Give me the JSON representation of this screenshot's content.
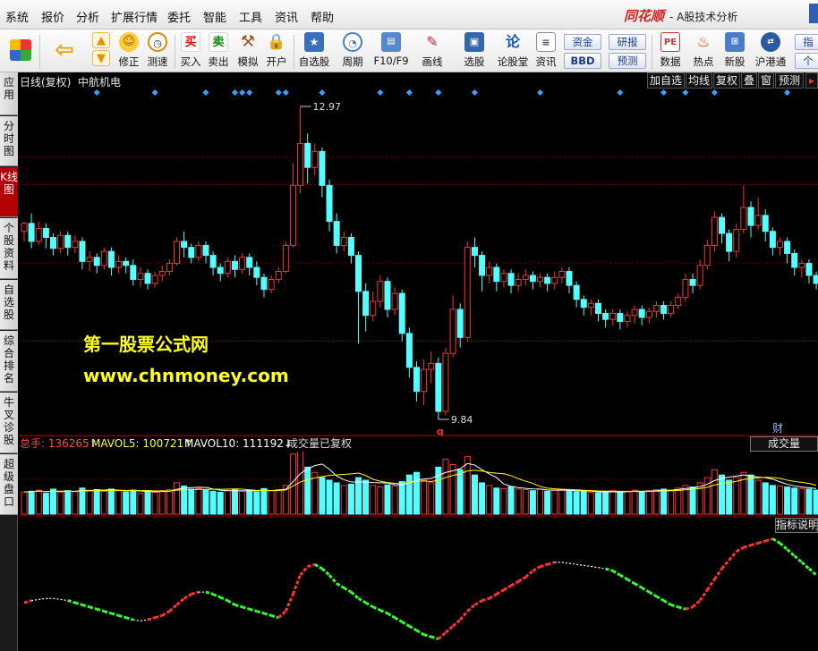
{
  "menubar": {
    "items": [
      "系统",
      "报价",
      "分析",
      "扩展行情",
      "委托",
      "智能",
      "工具",
      "资讯",
      "帮助"
    ],
    "brand": "同花顺",
    "subtitle": "- A股技术分析"
  },
  "toolbar": {
    "buttons": [
      {
        "label": "",
        "icon": "grid-icon"
      },
      {
        "label": "",
        "icon": "back-arrow-icon"
      },
      {
        "label": "修正",
        "icon": "smiley-icon"
      },
      {
        "label": "测速",
        "icon": "clock-icon"
      },
      {
        "label": "买入",
        "icon": "buy-icon",
        "glyph": "买"
      },
      {
        "label": "卖出",
        "icon": "sell-icon",
        "glyph": "卖"
      },
      {
        "label": "模拟",
        "icon": "hammer-icon"
      },
      {
        "label": "开户",
        "icon": "lock-icon"
      },
      {
        "label": "自选股",
        "icon": "star-folder-icon"
      },
      {
        "label": "周期",
        "icon": "period-icon"
      },
      {
        "label": "F10/F9",
        "icon": "f10-icon"
      },
      {
        "label": "画线",
        "icon": "pen-icon"
      },
      {
        "label": "选股",
        "icon": "monitor-icon"
      },
      {
        "label": "论股堂",
        "icon": "forum-icon",
        "glyph": "论"
      },
      {
        "label": "资讯",
        "icon": "news-icon"
      },
      {
        "label": "数据",
        "icon": "pe-icon",
        "glyph": "PE"
      },
      {
        "label": "热点",
        "icon": "hot-icon"
      },
      {
        "label": "新股",
        "icon": "ipo-icon"
      },
      {
        "label": "沪港通",
        "icon": "hk-icon"
      }
    ],
    "mini": {
      "fund": "资金",
      "bbd": "BBD",
      "research": "研报",
      "forecast": "预测",
      "index": "指",
      "stock": "个"
    }
  },
  "sidetabs": [
    {
      "label": "应用",
      "active": false
    },
    {
      "label": "分时图",
      "active": false
    },
    {
      "label": "K线图",
      "active": true
    },
    {
      "label": "个股资料",
      "active": false
    },
    {
      "label": "自选股",
      "active": false
    },
    {
      "label": "综合排名",
      "active": false
    },
    {
      "label": "牛叉诊股",
      "active": false
    },
    {
      "label": "超级盘口",
      "active": false
    }
  ],
  "chart_header": {
    "period": "日线(复权)",
    "stock": "中航机电",
    "buttons": [
      "加自选",
      "均线",
      "复权",
      "叠",
      "窗",
      "预测"
    ]
  },
  "price": {
    "high_label": "12.97",
    "low_label": "9.84",
    "low_marker": "q",
    "fin_marker": "财"
  },
  "watermark": {
    "line1": "第一股票公式网",
    "line2": "www.chnmoney.com"
  },
  "volume_header": {
    "total": "总手: 136265↑",
    "mavol5": "MAVOL5: 100721↑",
    "mavol10": "MAVOL10: 111192↓",
    "note": "成交量已复权",
    "tab": "成交量"
  },
  "indicator": {
    "tab": "指标说明"
  },
  "colors": {
    "up": "#ff3232",
    "down": "#54ffff",
    "ma5": "#ffffff",
    "ma10": "#ffff00",
    "ind_up": "#ff3232",
    "ind_down": "#32ff32",
    "ind_flat": "#ffffff"
  },
  "chart_data": {
    "type": "candlestick",
    "high": 12.97,
    "low": 9.84,
    "candles": [
      [
        11.72,
        11.8,
        11.62,
        11.82
      ],
      [
        11.8,
        11.62,
        11.55,
        11.9
      ],
      [
        11.62,
        11.75,
        11.58,
        11.82
      ],
      [
        11.75,
        11.66,
        11.55,
        11.8
      ],
      [
        11.66,
        11.55,
        11.48,
        11.7
      ],
      [
        11.55,
        11.68,
        11.5,
        11.72
      ],
      [
        11.68,
        11.56,
        11.48,
        11.72
      ],
      [
        11.56,
        11.62,
        11.5,
        11.68
      ],
      [
        11.62,
        11.42,
        11.34,
        11.66
      ],
      [
        11.42,
        11.46,
        11.32,
        11.52
      ],
      [
        11.46,
        11.38,
        11.3,
        11.5
      ],
      [
        11.38,
        11.52,
        11.34,
        11.56
      ],
      [
        11.52,
        11.36,
        11.28,
        11.56
      ],
      [
        11.36,
        11.42,
        11.3,
        11.48
      ],
      [
        11.42,
        11.38,
        11.3,
        11.46
      ],
      [
        11.38,
        11.24,
        11.18,
        11.44
      ],
      [
        11.24,
        11.3,
        11.16,
        11.36
      ],
      [
        11.3,
        11.2,
        11.14,
        11.34
      ],
      [
        11.2,
        11.28,
        11.16,
        11.32
      ],
      [
        11.28,
        11.32,
        11.22,
        11.38
      ],
      [
        11.32,
        11.4,
        11.28,
        11.44
      ],
      [
        11.4,
        11.62,
        11.38,
        11.66
      ],
      [
        11.62,
        11.56,
        11.46,
        11.72
      ],
      [
        11.56,
        11.46,
        11.4,
        11.6
      ],
      [
        11.46,
        11.58,
        11.42,
        11.62
      ],
      [
        11.58,
        11.48,
        11.4,
        11.62
      ],
      [
        11.48,
        11.36,
        11.28,
        11.52
      ],
      [
        11.36,
        11.3,
        11.22,
        11.4
      ],
      [
        11.3,
        11.42,
        11.26,
        11.46
      ],
      [
        11.42,
        11.34,
        11.26,
        11.48
      ],
      [
        11.34,
        11.46,
        11.3,
        11.5
      ],
      [
        11.46,
        11.36,
        11.28,
        11.5
      ],
      [
        11.36,
        11.26,
        11.18,
        11.42
      ],
      [
        11.26,
        11.14,
        11.06,
        11.3
      ],
      [
        11.14,
        11.24,
        11.1,
        11.28
      ],
      [
        11.24,
        11.32,
        11.2,
        11.36
      ],
      [
        11.32,
        11.58,
        11.3,
        11.62
      ],
      [
        11.58,
        12.18,
        11.56,
        12.4
      ],
      [
        12.18,
        12.6,
        12.1,
        12.97
      ],
      [
        12.6,
        12.36,
        12.2,
        12.7
      ],
      [
        12.36,
        12.52,
        12.28,
        12.6
      ],
      [
        12.52,
        12.18,
        12.06,
        12.56
      ],
      [
        12.18,
        11.82,
        11.72,
        12.24
      ],
      [
        11.82,
        11.58,
        11.5,
        11.9
      ],
      [
        11.58,
        11.66,
        11.52,
        11.72
      ],
      [
        11.66,
        11.48,
        11.4,
        11.7
      ],
      [
        11.48,
        11.12,
        10.6,
        11.52
      ],
      [
        11.12,
        10.88,
        10.72,
        11.2
      ],
      [
        10.88,
        11.02,
        10.82,
        11.12
      ],
      [
        11.02,
        11.22,
        10.96,
        11.28
      ],
      [
        11.22,
        10.94,
        10.86,
        11.26
      ],
      [
        10.94,
        11.1,
        10.88,
        11.16
      ],
      [
        11.1,
        10.7,
        10.62,
        11.14
      ],
      [
        10.7,
        10.36,
        10.26,
        10.76
      ],
      [
        10.36,
        10.12,
        10.02,
        10.42
      ],
      [
        10.12,
        10.34,
        9.98,
        10.44
      ],
      [
        10.34,
        10.4,
        10.2,
        10.52
      ],
      [
        10.4,
        9.92,
        9.84,
        10.46
      ],
      [
        9.92,
        10.5,
        9.88,
        10.56
      ],
      [
        10.5,
        10.94,
        10.46,
        11.08
      ],
      [
        10.94,
        10.66,
        10.56,
        11.0
      ],
      [
        10.66,
        11.56,
        10.62,
        11.62
      ],
      [
        11.56,
        11.48,
        11.36,
        11.66
      ],
      [
        11.48,
        11.28,
        11.12,
        11.52
      ],
      [
        11.28,
        11.36,
        11.2,
        11.42
      ],
      [
        11.36,
        11.22,
        11.12,
        11.4
      ],
      [
        11.22,
        11.3,
        11.16,
        11.34
      ],
      [
        11.3,
        11.18,
        11.1,
        11.34
      ],
      [
        11.18,
        11.24,
        11.12,
        11.3
      ],
      [
        11.24,
        11.28,
        11.18,
        11.34
      ],
      [
        11.28,
        11.22,
        11.14,
        11.32
      ],
      [
        11.22,
        11.26,
        11.16,
        11.3
      ],
      [
        11.26,
        11.2,
        11.12,
        11.3
      ],
      [
        11.2,
        11.26,
        11.14,
        11.32
      ],
      [
        11.26,
        11.32,
        11.2,
        11.36
      ],
      [
        11.32,
        11.18,
        11.1,
        11.36
      ],
      [
        11.18,
        11.04,
        10.96,
        11.22
      ],
      [
        11.04,
        10.96,
        10.88,
        11.08
      ],
      [
        10.96,
        11.0,
        10.88,
        11.04
      ],
      [
        11.0,
        10.9,
        10.82,
        11.04
      ],
      [
        10.9,
        10.84,
        10.76,
        10.94
      ],
      [
        10.84,
        10.9,
        10.78,
        10.94
      ],
      [
        10.9,
        10.82,
        10.74,
        10.94
      ],
      [
        10.82,
        10.88,
        10.76,
        10.92
      ],
      [
        10.88,
        10.94,
        10.8,
        10.98
      ],
      [
        10.94,
        10.86,
        10.78,
        10.98
      ],
      [
        10.86,
        10.92,
        10.8,
        10.96
      ],
      [
        10.92,
        10.98,
        10.86,
        11.02
      ],
      [
        10.98,
        10.9,
        10.84,
        11.02
      ],
      [
        10.9,
        10.98,
        10.86,
        11.02
      ],
      [
        10.98,
        11.06,
        10.94,
        11.1
      ],
      [
        11.06,
        11.24,
        11.02,
        11.3
      ],
      [
        11.24,
        11.18,
        11.1,
        11.3
      ],
      [
        11.18,
        11.38,
        11.14,
        11.44
      ],
      [
        11.38,
        11.58,
        11.34,
        11.64
      ],
      [
        11.58,
        11.86,
        11.52,
        11.92
      ],
      [
        11.86,
        11.7,
        11.6,
        11.9
      ],
      [
        11.7,
        11.52,
        11.42,
        11.74
      ],
      [
        11.52,
        11.74,
        11.46,
        11.8
      ],
      [
        11.74,
        11.96,
        11.7,
        12.18
      ],
      [
        11.96,
        11.78,
        11.66,
        12.02
      ],
      [
        11.78,
        11.88,
        11.74,
        12.06
      ],
      [
        11.88,
        11.72,
        11.62,
        11.94
      ],
      [
        11.72,
        11.56,
        11.48,
        11.76
      ],
      [
        11.56,
        11.62,
        11.48,
        11.66
      ],
      [
        11.62,
        11.5,
        11.4,
        11.66
      ],
      [
        11.5,
        11.36,
        11.28,
        11.54
      ],
      [
        11.36,
        11.4,
        11.26,
        11.44
      ],
      [
        11.4,
        11.28,
        11.2,
        11.44
      ],
      [
        11.28,
        11.2,
        11.14,
        11.32
      ]
    ],
    "volumes": [
      85,
      88,
      92,
      80,
      96,
      84,
      90,
      86,
      100,
      92,
      94,
      88,
      96,
      90,
      86,
      92,
      80,
      88,
      84,
      90,
      94,
      120,
      108,
      96,
      98,
      92,
      88,
      84,
      90,
      96,
      88,
      92,
      86,
      98,
      90,
      94,
      110,
      230,
      250,
      180,
      160,
      140,
      130,
      120,
      110,
      115,
      140,
      130,
      110,
      105,
      112,
      108,
      125,
      150,
      160,
      130,
      120,
      180,
      210,
      190,
      170,
      220,
      150,
      120,
      110,
      100,
      98,
      105,
      96,
      94,
      90,
      96,
      88,
      92,
      94,
      90,
      86,
      88,
      84,
      82,
      86,
      90,
      84,
      88,
      92,
      86,
      90,
      94,
      96,
      92,
      100,
      110,
      104,
      120,
      140,
      170,
      150,
      130,
      140,
      160,
      150,
      130,
      120,
      110,
      108,
      104,
      100,
      98,
      96,
      92
    ],
    "indicator": [
      0.12,
      0.14,
      0.15,
      0.16,
      0.16,
      0.15,
      0.14,
      0.12,
      0.1,
      0.08,
      0.06,
      0.04,
      0.02,
      0.0,
      -0.02,
      -0.04,
      -0.05,
      -0.04,
      -0.02,
      0.0,
      0.04,
      0.1,
      0.16,
      0.2,
      0.22,
      0.22,
      0.2,
      0.17,
      0.14,
      0.1,
      0.08,
      0.06,
      0.04,
      0.02,
      0.0,
      -0.02,
      0.04,
      0.2,
      0.38,
      0.46,
      0.48,
      0.44,
      0.38,
      0.3,
      0.26,
      0.22,
      0.16,
      0.12,
      0.08,
      0.05,
      0.02,
      -0.02,
      -0.06,
      -0.1,
      -0.14,
      -0.18,
      -0.2,
      -0.22,
      -0.16,
      -0.1,
      -0.04,
      0.04,
      0.1,
      0.14,
      0.16,
      0.2,
      0.24,
      0.28,
      0.32,
      0.36,
      0.42,
      0.46,
      0.48,
      0.5,
      0.5,
      0.49,
      0.48,
      0.47,
      0.46,
      0.45,
      0.44,
      0.42,
      0.38,
      0.34,
      0.3,
      0.26,
      0.22,
      0.18,
      0.14,
      0.1,
      0.08,
      0.06,
      0.08,
      0.14,
      0.24,
      0.34,
      0.44,
      0.52,
      0.6,
      0.64,
      0.66,
      0.68,
      0.7,
      0.72,
      0.68,
      0.62,
      0.56,
      0.5,
      0.44,
      0.38
    ]
  }
}
